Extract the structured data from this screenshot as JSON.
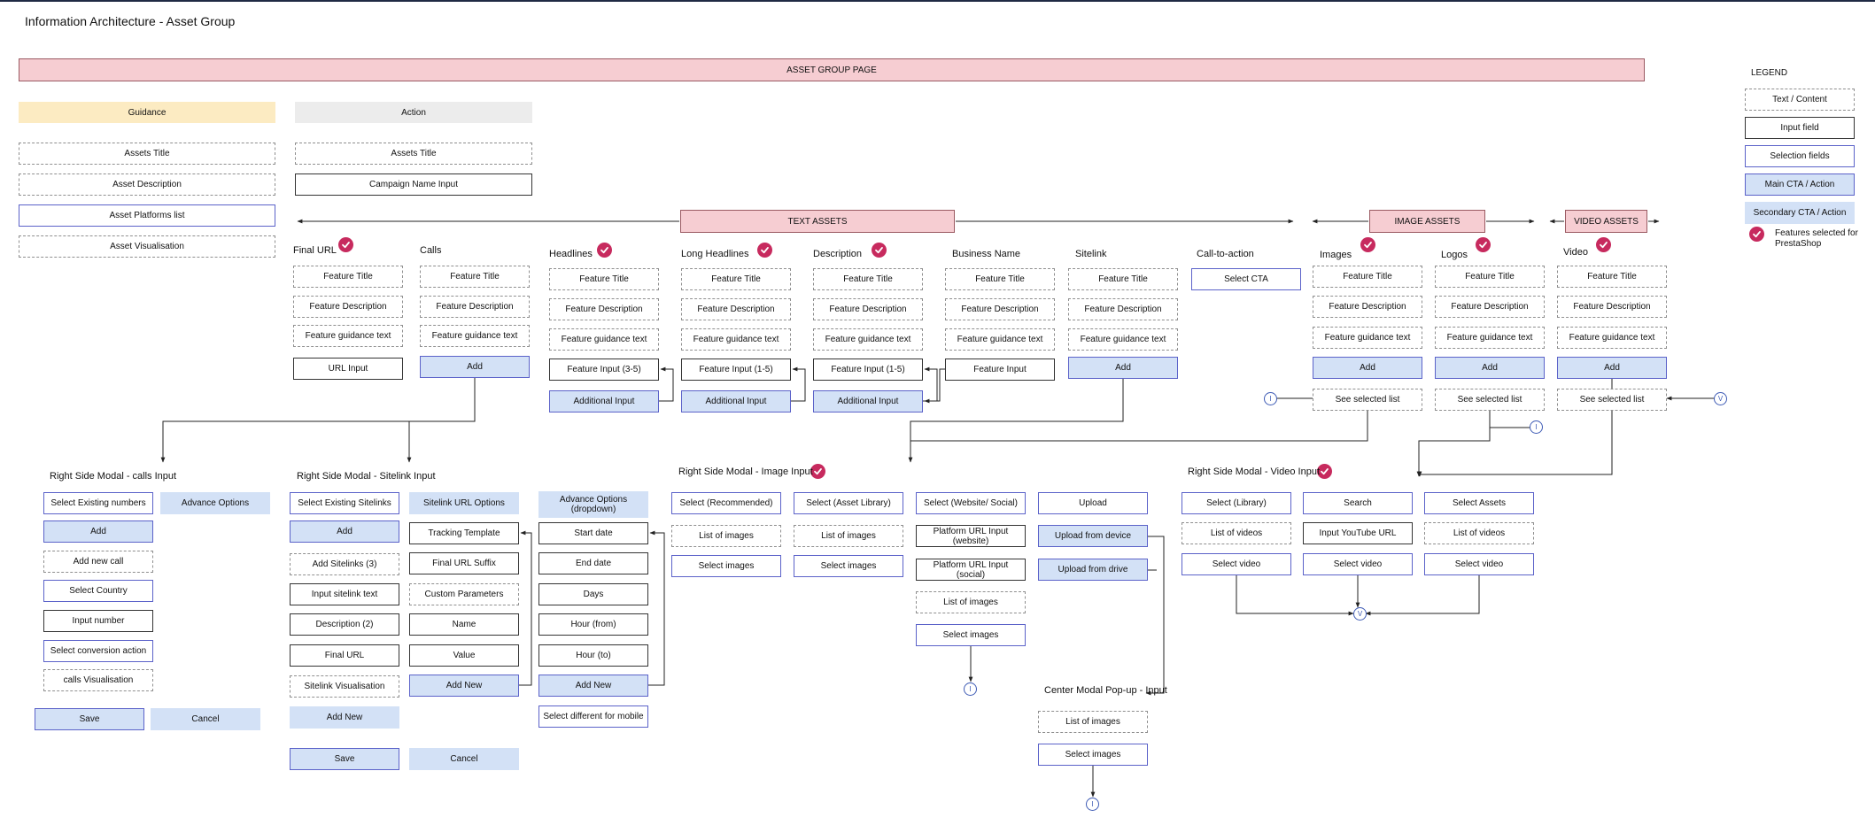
{
  "title": "Information Architecture - Asset Group",
  "page_banner": "ASSET GROUP PAGE",
  "columns": {
    "guidance": "Guidance",
    "action": "Action"
  },
  "guidance_items": [
    "Assets Title",
    "Asset Description",
    "Asset Platforms list",
    "Asset Visualisation"
  ],
  "action_items": [
    "Assets Title",
    "Campaign Name Input"
  ],
  "section_labels": {
    "text_assets": "TEXT ASSETS",
    "image_assets": "IMAGE ASSETS",
    "video_assets": "VIDEO ASSETS"
  },
  "features": {
    "final_url": {
      "title": "Final URL",
      "items": [
        "Feature Title",
        "Feature Description",
        "Feature guidance text",
        "URL Input"
      ]
    },
    "calls": {
      "title": "Calls",
      "items": [
        "Feature Title",
        "Feature Description",
        "Feature guidance text",
        "Add"
      ]
    },
    "headlines": {
      "title": "Headlines",
      "items": [
        "Feature Title",
        "Feature Description",
        "Feature guidance text",
        "Feature Input (3-5)",
        "Additional Input"
      ]
    },
    "long_headlines": {
      "title": "Long Headlines",
      "items": [
        "Feature Title",
        "Feature Description",
        "Feature guidance text",
        "Feature Input (1-5)",
        "Additional Input"
      ]
    },
    "description": {
      "title": "Description",
      "items": [
        "Feature Title",
        "Feature Description",
        "Feature guidance text",
        "Feature Input (1-5)",
        "Additional Input"
      ]
    },
    "business_name": {
      "title": "Business Name",
      "items": [
        "Feature Title",
        "Feature Description",
        "Feature guidance text",
        "Feature Input"
      ]
    },
    "sitelink": {
      "title": "Sitelink",
      "items": [
        "Feature Title",
        "Feature Description",
        "Feature guidance text",
        "Add"
      ]
    },
    "cta": {
      "title": "Call-to-action",
      "items": [
        "Select CTA"
      ]
    },
    "images": {
      "title": "Images",
      "items": [
        "Feature Title",
        "Feature Description",
        "Feature guidance text",
        "Add",
        "See selected list"
      ]
    },
    "logos": {
      "title": "Logos",
      "items": [
        "Feature Title",
        "Feature Description",
        "Feature guidance text",
        "Add",
        "See selected list"
      ]
    },
    "video": {
      "title": "Video",
      "items": [
        "Feature Title",
        "Feature Description",
        "Feature guidance text",
        "Add",
        "See selected list"
      ]
    }
  },
  "calls_modal": {
    "title": "Right Side Modal - calls Input",
    "items": [
      "Select Existing numbers",
      "Advance Options",
      "Add",
      "Add new call",
      "Select Country",
      "Input number",
      "Select conversion action",
      "calls Visualisation",
      "Save",
      "Cancel"
    ]
  },
  "sitelink_modal": {
    "title": "Right Side Modal - Sitelink Input",
    "col1": [
      "Select Existing Sitelinks",
      "Add",
      "Add Sitelinks (3)",
      "Input sitelink text",
      "Description (2)",
      "Final URL",
      "Sitelink Visualisation",
      "Add New",
      "Save"
    ],
    "col2": [
      "Sitelink URL Options",
      "Tracking Template",
      "Final URL Suffix",
      "Custom Parameters",
      "Name",
      "Value",
      "Add New",
      "Cancel"
    ],
    "col3": [
      "Advance Options (dropdown)",
      "Start date",
      "End date",
      "Days",
      "Hour (from)",
      "Hour (to)",
      "Add New",
      "Select different for mobile"
    ]
  },
  "image_modal": {
    "title": "Right Side Modal - Image Input",
    "col1": [
      "Select (Recommended)",
      "List of images",
      "Select images"
    ],
    "col2": [
      "Select (Asset Library)",
      "List of images",
      "Select images"
    ],
    "col3": [
      "Select (Website/ Social)",
      "Platform URL Input (website)",
      "Platform URL Input (social)",
      "List of images",
      "Select images"
    ],
    "col4": [
      "Upload",
      "Upload from device",
      "Upload from drive"
    ]
  },
  "center_modal": {
    "title": "Center Modal Pop-up - Input",
    "items": [
      "List of images",
      "Select images"
    ]
  },
  "video_modal": {
    "title": "Right Side Modal - Video Input",
    "col1": [
      "Select (Library)",
      "List of videos",
      "Select video"
    ],
    "col2": [
      "Search",
      "Input YouTube URL",
      "Select video"
    ],
    "col3": [
      "Select Assets",
      "List of videos",
      "Select video"
    ]
  },
  "connectors": {
    "i": "I",
    "v": "V"
  },
  "legend": {
    "title": "LEGEND",
    "items": [
      "Text / Content",
      "Input field",
      "Selection fields",
      "Main CTA / Action",
      "Secondary CTA / Action"
    ],
    "check_note": "Features selected for PrestaShop"
  },
  "colors": {
    "pink": "#f6cdd2",
    "guidance": "#fcebc2",
    "action": "#ececec",
    "blue_fill": "#d3e1f6",
    "blue_border": "#5b62c9",
    "check": "#c72a5e"
  }
}
